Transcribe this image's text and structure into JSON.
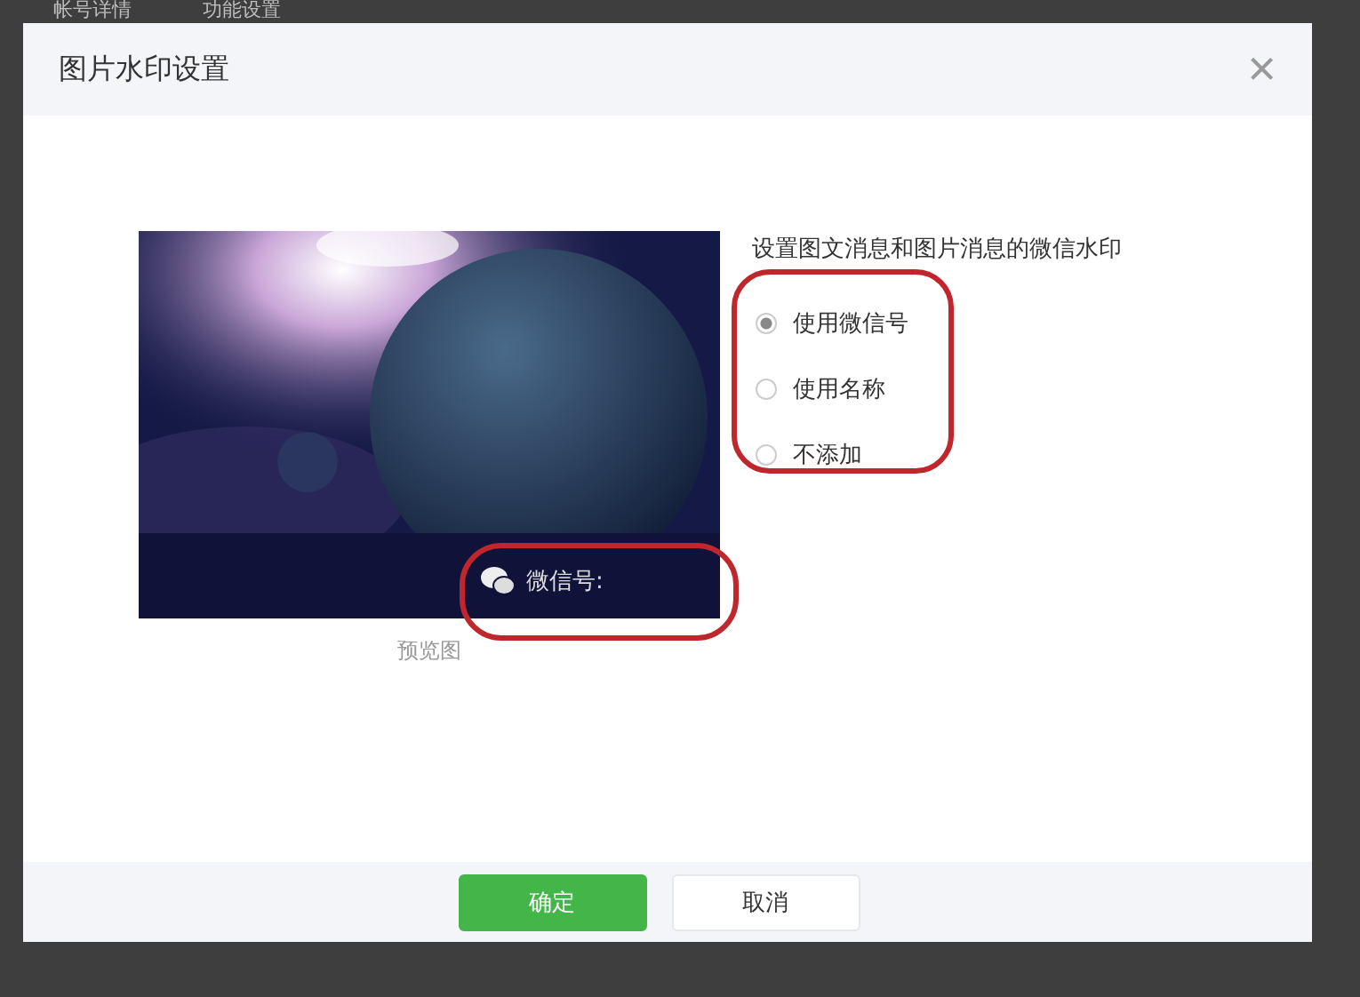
{
  "background_tabs": [
    "帐号详情",
    "功能设置"
  ],
  "dialog": {
    "title": "图片水印设置",
    "close": "×",
    "preview": {
      "watermark": "微信号:",
      "caption": "预览图"
    },
    "settings": {
      "label": "设置图文消息和图片消息的微信水印",
      "options": [
        {
          "label": "使用微信号",
          "selected": true
        },
        {
          "label": "使用名称",
          "selected": false
        },
        {
          "label": "不添加",
          "selected": false
        }
      ]
    },
    "buttons": [
      {
        "label": "确定",
        "kind": "primary"
      },
      {
        "label": "取消",
        "kind": "default"
      }
    ]
  }
}
